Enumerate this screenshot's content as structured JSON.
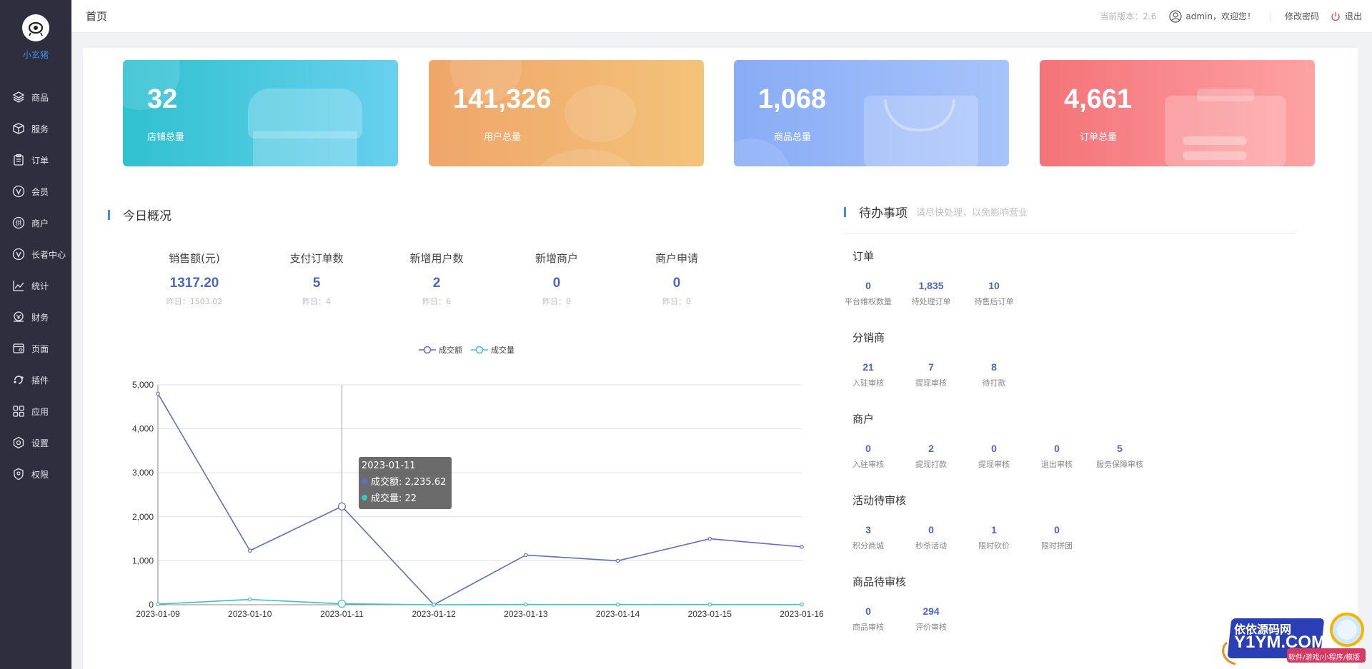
{
  "app": {
    "logo_name": "小玄猪"
  },
  "sidebar": {
    "items": [
      {
        "label": "商品",
        "icon": "layers-icon"
      },
      {
        "label": "服务",
        "icon": "box-icon"
      },
      {
        "label": "订单",
        "icon": "clipboard-icon"
      },
      {
        "label": "会员",
        "icon": "member-icon"
      },
      {
        "label": "商户",
        "icon": "supplier-icon"
      },
      {
        "label": "长者中心",
        "icon": "elder-icon"
      },
      {
        "label": "统计",
        "icon": "chart-icon"
      },
      {
        "label": "财务",
        "icon": "finance-icon"
      },
      {
        "label": "页面",
        "icon": "page-icon"
      },
      {
        "label": "插件",
        "icon": "plugin-icon"
      },
      {
        "label": "应用",
        "icon": "apps-icon"
      },
      {
        "label": "设置",
        "icon": "settings-icon"
      },
      {
        "label": "权限",
        "icon": "shield-icon"
      }
    ]
  },
  "header": {
    "title": "首页",
    "version": "当前版本：2.6",
    "user": "admin，欢迎您！",
    "change_password": "修改密码",
    "logout": "退出"
  },
  "cards": [
    {
      "value": "32",
      "label": "店铺总量"
    },
    {
      "value": "141,326",
      "label": "用户总量"
    },
    {
      "value": "1,068",
      "label": "商品总量"
    },
    {
      "value": "4,661",
      "label": "订单总量"
    }
  ],
  "today": {
    "title": "今日概况",
    "stats": [
      {
        "title": "销售额(元)",
        "value": "1317.20",
        "yesterday": "昨日：1503.02"
      },
      {
        "title": "支付订单数",
        "value": "5",
        "yesterday": "昨日：4"
      },
      {
        "title": "新增用户数",
        "value": "2",
        "yesterday": "昨日：6"
      },
      {
        "title": "新增商户",
        "value": "0",
        "yesterday": "昨日：0"
      },
      {
        "title": "商户申请",
        "value": "0",
        "yesterday": "昨日：0"
      }
    ]
  },
  "chart_data": {
    "type": "line",
    "x": [
      "2023-01-09",
      "2023-01-10",
      "2023-01-11",
      "2023-01-12",
      "2023-01-13",
      "2023-01-14",
      "2023-01-15",
      "2023-01-16"
    ],
    "y_ticks": [
      "0",
      "1,000",
      "2,000",
      "3,000",
      "4,000",
      "5,000"
    ],
    "ylim": [
      0,
      5000
    ],
    "grid": true,
    "legend_position": "top-center",
    "series": [
      {
        "name": "成交额",
        "color": "#5b6fc9",
        "values": [
          4800,
          1230,
          2235.62,
          0,
          1130,
          1000,
          1500,
          1317.2
        ]
      },
      {
        "name": "成交量",
        "color": "#3ec3c3",
        "values": [
          15,
          120,
          22,
          0,
          5,
          4,
          6,
          5
        ]
      }
    ],
    "tooltip": {
      "title": "2023-01-11",
      "rows": [
        "成交额: 2,235.62",
        "成交量: 22"
      ]
    }
  },
  "todo": {
    "title": "待办事项",
    "subtitle": "请尽快处理，以免影响营业",
    "groups": [
      {
        "title": "订单",
        "items": [
          {
            "value": "0",
            "label": "平台维权数量"
          },
          {
            "value": "1,835",
            "label": "待处理订单"
          },
          {
            "value": "10",
            "label": "待售后订单"
          }
        ]
      },
      {
        "title": "分销商",
        "items": [
          {
            "value": "21",
            "label": "入驻审核"
          },
          {
            "value": "7",
            "label": "提现审核"
          },
          {
            "value": "8",
            "label": "待打款"
          }
        ]
      },
      {
        "title": "商户",
        "items": [
          {
            "value": "0",
            "label": "入驻审核"
          },
          {
            "value": "2",
            "label": "提现打款"
          },
          {
            "value": "0",
            "label": "提现审核"
          },
          {
            "value": "0",
            "label": "退出审核"
          },
          {
            "value": "5",
            "label": "服务保障审核"
          }
        ]
      },
      {
        "title": "活动待审核",
        "items": [
          {
            "value": "3",
            "label": "积分商城"
          },
          {
            "value": "0",
            "label": "秒杀活动"
          },
          {
            "value": "1",
            "label": "限时砍价"
          },
          {
            "value": "0",
            "label": "限时拼团"
          }
        ]
      },
      {
        "title": "商品待审核",
        "items": [
          {
            "value": "0",
            "label": "商品审核"
          },
          {
            "value": "294",
            "label": "评价审核"
          }
        ]
      }
    ]
  },
  "watermark": {
    "line1": "依依源码网",
    "line2": "Y1YM.COM",
    "line3": "软件/游戏/小程序/模版"
  }
}
